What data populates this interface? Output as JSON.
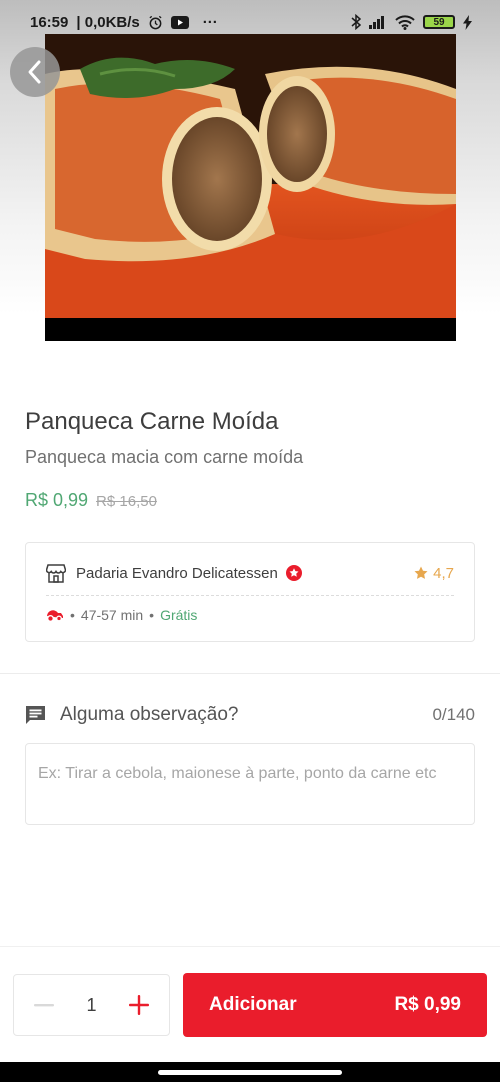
{
  "status_bar": {
    "time": "16:59",
    "net_speed": "0,0KB/s",
    "more": "···",
    "battery": "59"
  },
  "product": {
    "title": "Panqueca Carne Moída",
    "description": "Panqueca macia com carne moída",
    "price": "R$ 0,99",
    "original_price": "R$ 16,50"
  },
  "store": {
    "name": "Padaria Evandro Delicatessen",
    "rating": "4,7",
    "delivery_time": "47-57 min",
    "delivery_fee": "Grátis",
    "separator": "•"
  },
  "observation": {
    "label": "Alguma observação?",
    "counter": "0/140",
    "placeholder": "Ex: Tirar a cebola, maionese à parte, ponto da carne etc",
    "value": ""
  },
  "footer": {
    "quantity": "1",
    "add_label": "Adicionar",
    "total": "R$ 0,99"
  },
  "colors": {
    "brand_red": "#ea1d2c",
    "price_green": "#50a773",
    "rating_gold": "#e7a74e"
  },
  "icons": [
    "back-icon",
    "store-icon",
    "super-restaurant-icon",
    "star-icon",
    "delivery-icon",
    "comment-icon",
    "minus-icon",
    "plus-icon"
  ]
}
